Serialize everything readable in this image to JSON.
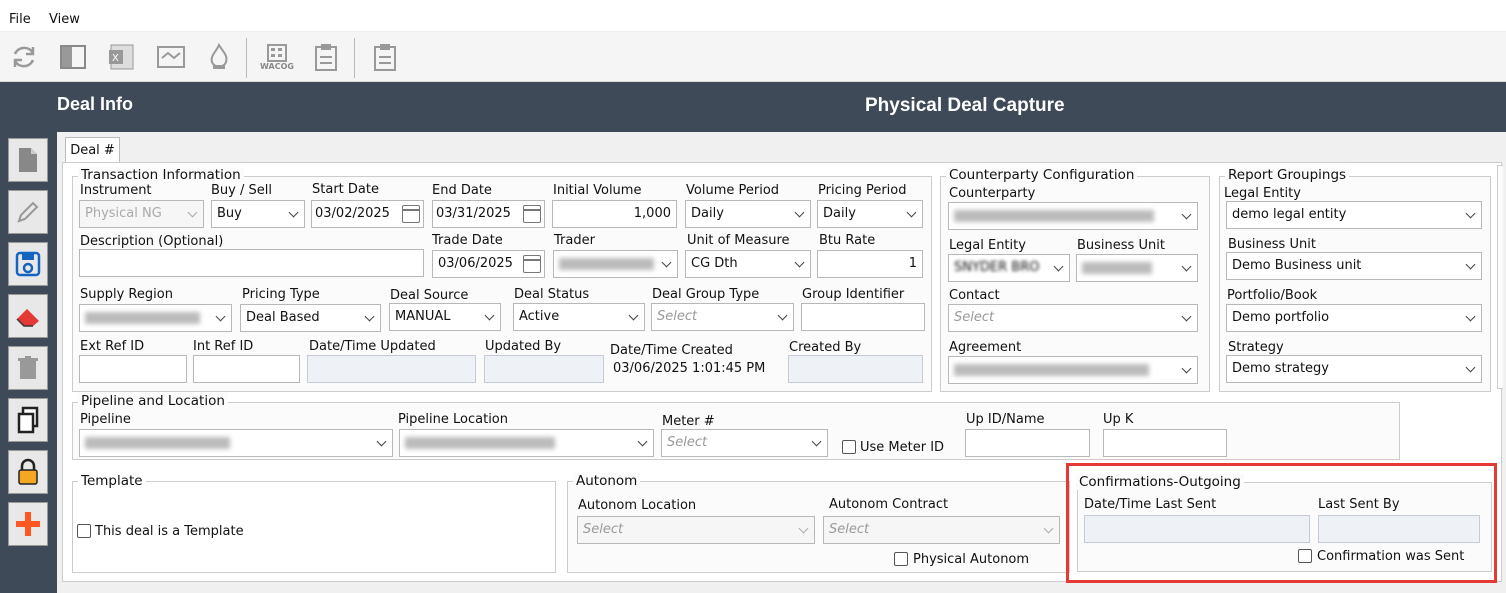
{
  "menu": {
    "file": "File",
    "view": "View"
  },
  "toolbar": {
    "buttons": [
      "refresh-icon",
      "panel-icon",
      "excel-icon",
      "handshake-icon",
      "fire-icon",
      "wacog-icon",
      "clipboard-icon",
      "clipboard-icon"
    ],
    "wacog_label": "WACOG"
  },
  "header": {
    "left_title": "Deal Info",
    "center_title": "Physical Deal Capture"
  },
  "sidebar": {
    "buttons": [
      "new-document-icon",
      "edit-pencil-icon",
      "save-icon",
      "eraser-icon",
      "trash-icon",
      "copy-icon",
      "lock-icon",
      "add-cross-icon"
    ]
  },
  "tab": {
    "label": "Deal #"
  },
  "transaction": {
    "title": "Transaction Information",
    "instrument_label": "Instrument",
    "instrument_value": "Physical NG",
    "buysell_label": "Buy / Sell",
    "buysell_value": "Buy",
    "start_date_label": "Start Date",
    "start_date_value": "03/02/2025",
    "end_date_label": "End Date",
    "end_date_value": "03/31/2025",
    "initial_volume_label": "Initial Volume",
    "initial_volume_value": "1,000",
    "volume_period_label": "Volume Period",
    "volume_period_value": "Daily",
    "pricing_period_label": "Pricing Period",
    "pricing_period_value": "Daily",
    "description_label": "Description (Optional)",
    "trade_date_label": "Trade Date",
    "trade_date_value": "03/06/2025",
    "trader_label": "Trader",
    "uom_label": "Unit of Measure",
    "uom_value": "CG Dth",
    "btu_label": "Btu Rate",
    "btu_value": "1",
    "supply_region_label": "Supply Region",
    "pricing_type_label": "Pricing Type",
    "pricing_type_value": "Deal Based",
    "deal_source_label": "Deal Source",
    "deal_source_value": "MANUAL",
    "deal_status_label": "Deal Status",
    "deal_status_value": "Active",
    "deal_group_type_label": "Deal Group Type",
    "deal_group_type_placeholder": "Select",
    "group_identifier_label": "Group Identifier",
    "ext_ref_label": "Ext Ref ID",
    "int_ref_label": "Int Ref ID",
    "dt_updated_label": "Date/Time Updated",
    "updated_by_label": "Updated By",
    "dt_created_label": "Date/Time Created",
    "dt_created_value": "03/06/2025 1:01:45 PM",
    "created_by_label": "Created By"
  },
  "counterparty": {
    "title": "Counterparty Configuration",
    "counterparty_label": "Counterparty",
    "legal_entity_label": "Legal Entity",
    "legal_entity_value": "SNYDER BRO",
    "business_unit_label": "Business Unit",
    "contact_label": "Contact",
    "contact_placeholder": "Select",
    "agreement_label": "Agreement"
  },
  "report_groupings": {
    "title": "Report Groupings",
    "legal_entity_label": "Legal Entity",
    "legal_entity_value": "demo legal entity",
    "business_unit_label": "Business Unit",
    "business_unit_value": "Demo Business unit",
    "portfolio_label": "Portfolio/Book",
    "portfolio_value": "Demo portfolio",
    "strategy_label": "Strategy",
    "strategy_value": "Demo strategy"
  },
  "pipeline": {
    "title": "Pipeline and Location",
    "pipeline_label": "Pipeline",
    "location_label": "Pipeline Location",
    "meter_label": "Meter #",
    "meter_placeholder": "Select",
    "use_meter_label": "Use Meter ID",
    "upid_label": "Up ID/Name",
    "upk_label": "Up K"
  },
  "template": {
    "title": "Template",
    "checkbox_label": "This deal is a Template"
  },
  "autonom": {
    "title": "Autonom",
    "location_label": "Autonom Location",
    "location_placeholder": "Select",
    "contract_label": "Autonom Contract",
    "contract_placeholder": "Select",
    "physical_label": "Physical Autonom"
  },
  "confirmations": {
    "title": "Confirmations-Outgoing",
    "last_sent_label": "Date/Time Last Sent",
    "last_sent_by_label": "Last Sent By",
    "was_sent_label": "Confirmation was Sent"
  },
  "colors": {
    "header_bg": "#3e4a57",
    "highlight": "#e53935",
    "save_icon": "#1565c0",
    "eraser_icon": "#e53935",
    "lock_icon": "#f5a623",
    "add_icon": "#ff5722"
  }
}
